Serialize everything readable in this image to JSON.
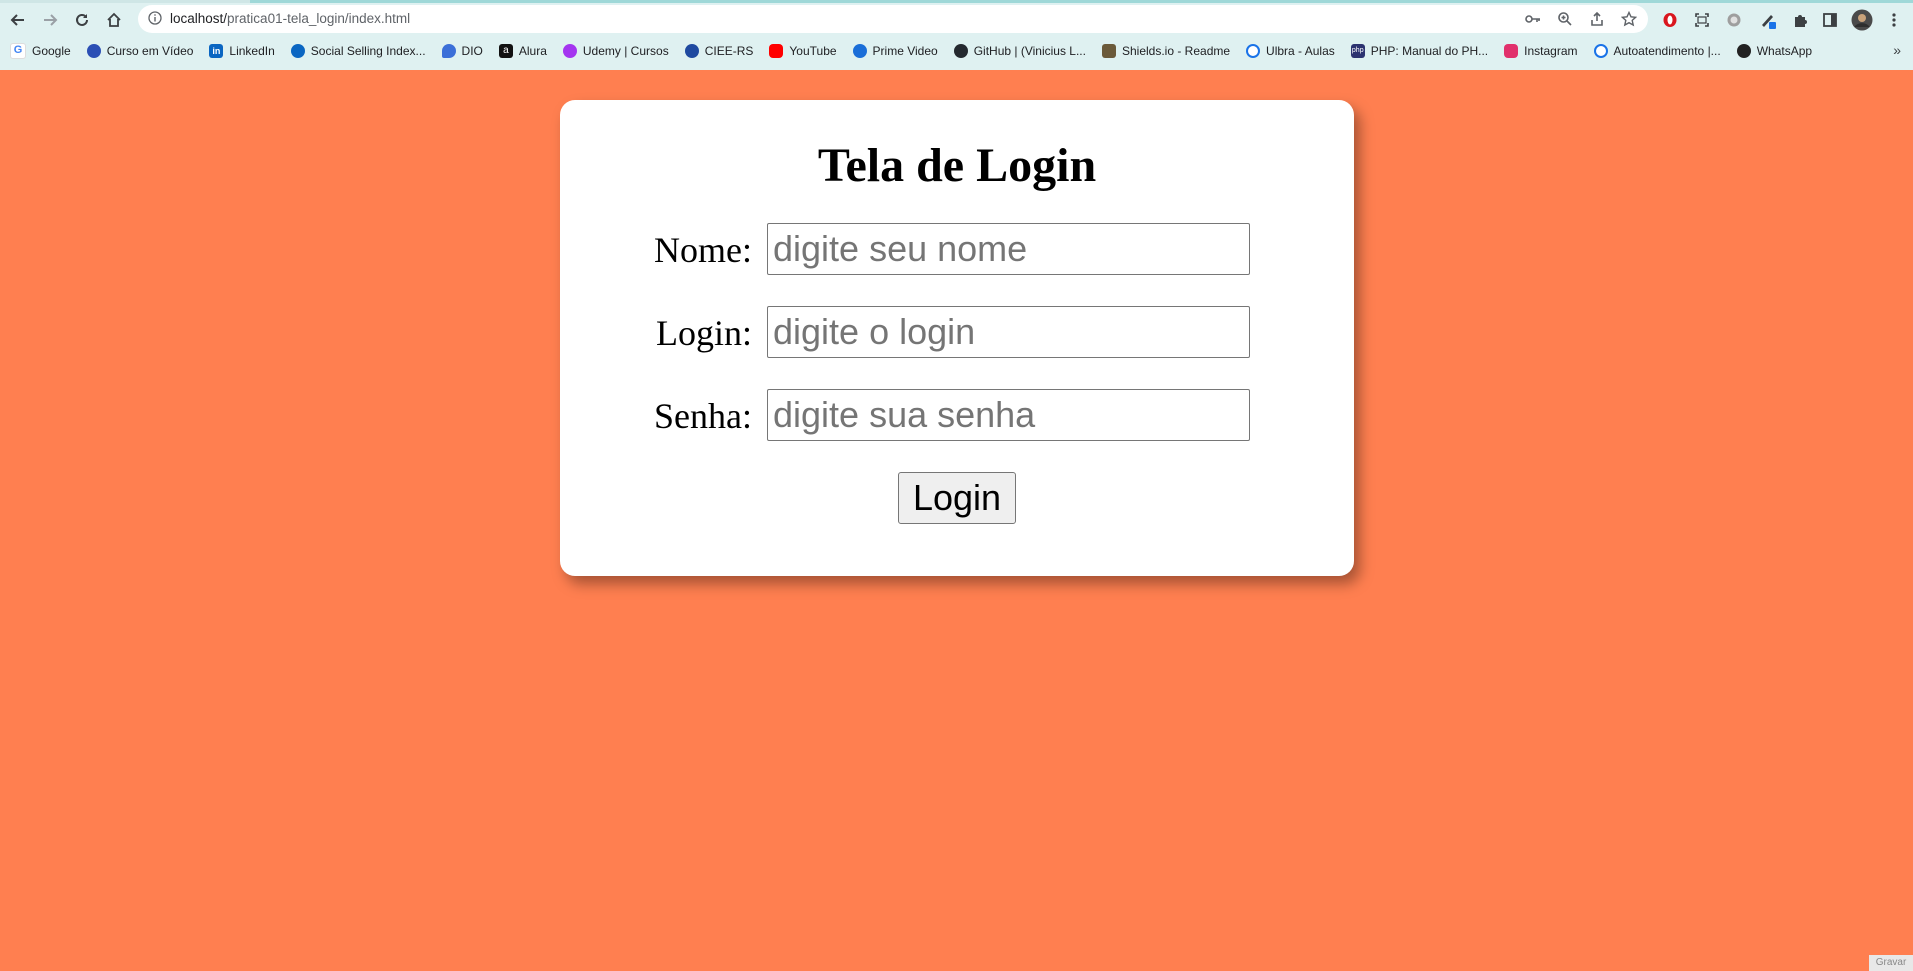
{
  "browser": {
    "url_host": "localhost/",
    "url_path": "pratica01-tela_login/index.html",
    "bookmarks": [
      {
        "label": "Google",
        "icon": "google-icon",
        "color": "#4285f4"
      },
      {
        "label": "Curso em Vídeo",
        "icon": "cursoemvideo-icon",
        "color": "#2b4fb5"
      },
      {
        "label": "LinkedIn",
        "icon": "linkedin-icon",
        "color": "#0a66c2"
      },
      {
        "label": "Social Selling Index...",
        "icon": "compass-icon",
        "color": "#0a66c2"
      },
      {
        "label": "DIO",
        "icon": "dio-icon",
        "color": "#3b6fd8"
      },
      {
        "label": "Alura",
        "icon": "alura-icon",
        "color": "#111111"
      },
      {
        "label": "Udemy | Cursos",
        "icon": "udemy-icon",
        "color": "#a435f0"
      },
      {
        "label": "CIEE-RS",
        "icon": "ciee-icon",
        "color": "#1f4aa0"
      },
      {
        "label": "YouTube",
        "icon": "youtube-icon",
        "color": "#ff0000"
      },
      {
        "label": "Prime Video",
        "icon": "primevideo-icon",
        "color": "#1a6ed8"
      },
      {
        "label": "GitHub | (Vinicius L...",
        "icon": "github-icon",
        "color": "#24292f"
      },
      {
        "label": "Shields.io - Readme",
        "icon": "shields-icon",
        "color": "#6b5a3a"
      },
      {
        "label": "Ulbra - Aulas",
        "icon": "ulbra-icon",
        "color": "#1a73e8"
      },
      {
        "label": "PHP: Manual do PH...",
        "icon": "php-icon",
        "color": "#2c3370"
      },
      {
        "label": "Instagram",
        "icon": "instagram-icon",
        "color": "#e1306c"
      },
      {
        "label": "Autoatendimento |...",
        "icon": "autoatendimento-icon",
        "color": "#1a73e8"
      },
      {
        "label": "WhatsApp",
        "icon": "whatsapp-icon",
        "color": "#222222"
      }
    ],
    "more_label": "»"
  },
  "page": {
    "background": "#ff7f50",
    "title": "Tela de Login",
    "fields": [
      {
        "label": "Nome:",
        "placeholder": "digite seu nome",
        "value": ""
      },
      {
        "label": "Login:",
        "placeholder": "digite o login",
        "value": ""
      },
      {
        "label": "Senha:",
        "placeholder": "digite sua senha",
        "value": ""
      }
    ],
    "submit_label": "Login"
  },
  "footer": {
    "record_label": "Gravar"
  }
}
